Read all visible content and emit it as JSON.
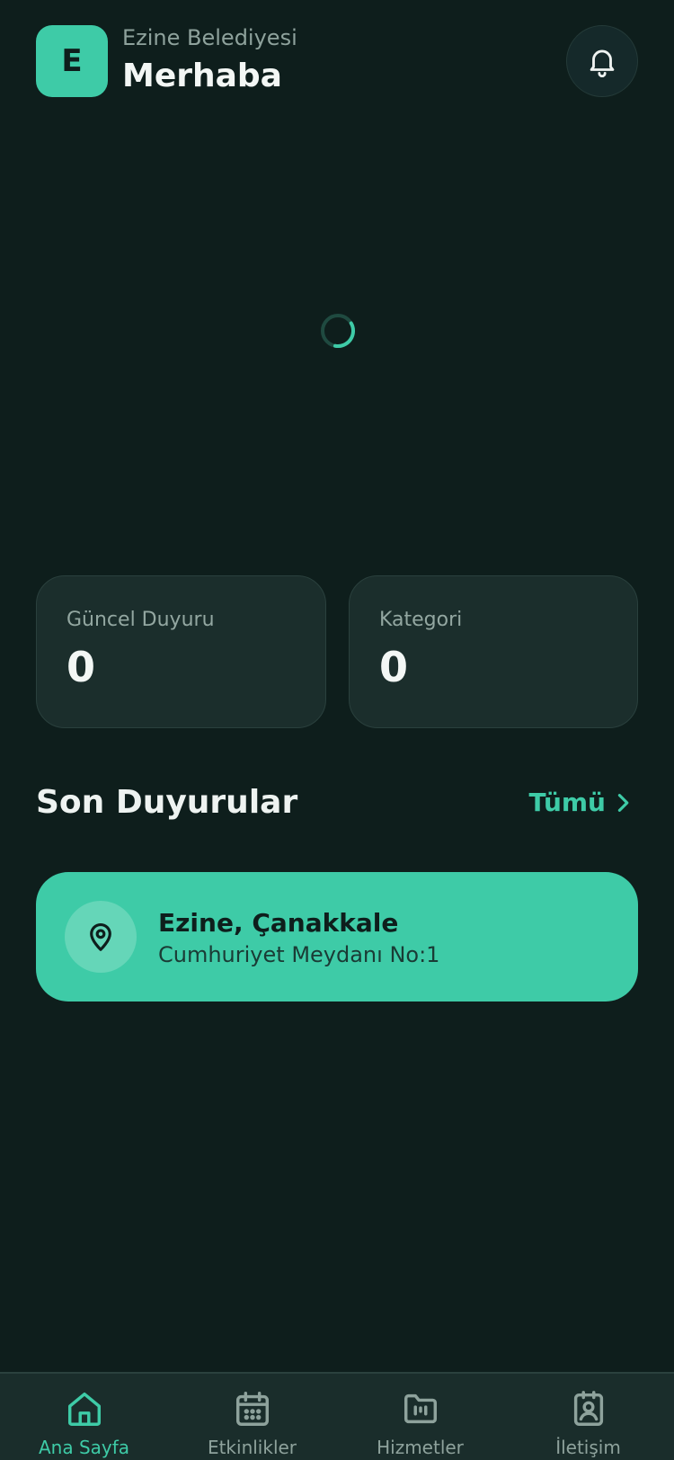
{
  "header": {
    "logo_letter": "E",
    "org_name": "Ezine Belediyesi",
    "greeting": "Merhaba"
  },
  "stats": [
    {
      "label": "Güncel Duyuru",
      "value": "0"
    },
    {
      "label": "Kategori",
      "value": "0"
    }
  ],
  "announcements": {
    "title": "Son Duyurular",
    "see_all_label": "Tümü"
  },
  "location": {
    "title": "Ezine, Çanakkale",
    "address": "Cumhuriyet Meydanı No:1"
  },
  "nav": [
    {
      "label": "Ana Sayfa",
      "icon": "home-icon",
      "active": true
    },
    {
      "label": "Etkinlikler",
      "icon": "calendar-icon",
      "active": false
    },
    {
      "label": "Hizmetler",
      "icon": "folder-icon",
      "active": false
    },
    {
      "label": "İletişim",
      "icon": "contact-icon",
      "active": false
    }
  ],
  "colors": {
    "background": "#0e1e1c",
    "accent": "#3ecba7",
    "card": "#1b2e2c",
    "muted_text": "#8ea29c"
  }
}
